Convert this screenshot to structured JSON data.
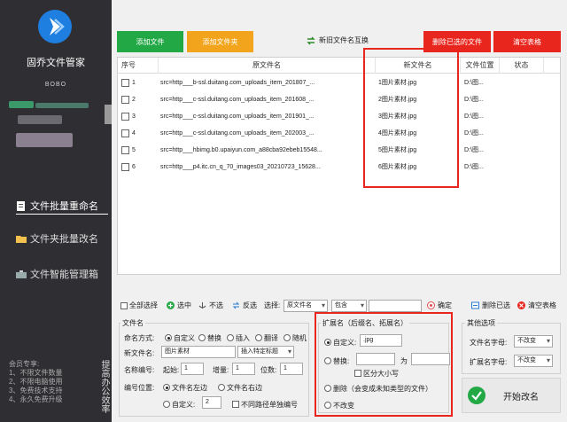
{
  "sidebar": {
    "app_title": "固乔文件管家",
    "app_subtitle": "BOBO",
    "nav": [
      {
        "label": "文件批量重命名"
      },
      {
        "label": "文件夹批量改名"
      },
      {
        "label": "文件智能管理箱"
      }
    ],
    "member_lines": [
      "会员专享:",
      "1、不限文件数量",
      "2、不限电脑使用",
      "3、免费技术支持",
      "4、永久免费升级"
    ],
    "vertical_text": "提高办公效率"
  },
  "toolbar": {
    "add_file": "添加文件",
    "add_folder": "添加文件夹",
    "swap_names": "新旧文件名互换",
    "delete_selected": "删除已选的文件",
    "clear_table": "清空表格"
  },
  "table": {
    "headers": {
      "index": "序号",
      "original": "原文件名",
      "new_name": "新文件名",
      "location": "文件位置",
      "status": "状态"
    },
    "rows": [
      {
        "index": "1",
        "original": "src=http___b-ssl.duitang.com_uploads_item_201807_...",
        "new_name": "1图片素材.jpg",
        "location": "D:\\图..."
      },
      {
        "index": "2",
        "original": "src=http___c-ssl.duitang.com_uploads_item_201608_...",
        "new_name": "2图片素材.jpg",
        "location": "D:\\图..."
      },
      {
        "index": "3",
        "original": "src=http___c-ssl.duitang.com_uploads_item_201901_...",
        "new_name": "3图片素材.jpg",
        "location": "D:\\图..."
      },
      {
        "index": "4",
        "original": "src=http___c-ssl.duitang.com_uploads_item_202003_...",
        "new_name": "4图片素材.jpg",
        "location": "D:\\图..."
      },
      {
        "index": "5",
        "original": "src=http___hbimg.b0.upaiyun.com_a88cba92ebeb15548...",
        "new_name": "5图片素材.jpg",
        "location": "D:\\图..."
      },
      {
        "index": "6",
        "original": "src=http___p4.itc.cn_q_70_images03_20210723_15628...",
        "new_name": "6图片素材.jpg",
        "location": "D:\\图..."
      }
    ]
  },
  "selection_bar": {
    "select_all": "全部选择",
    "select": "选中",
    "unselect": "不选",
    "invert": "反选",
    "select_label": "选择:",
    "field_value": "原文件名",
    "match_value": "包含",
    "confirm": "确定",
    "delete_selected": "删除已选",
    "clear_table": "清空表格"
  },
  "filename_panel": {
    "title": "文件名",
    "naming_label": "命名方式:",
    "naming_options": [
      "自定义",
      "替换",
      "插入",
      "翻译",
      "随机"
    ],
    "newname_label": "新文件名:",
    "newname_value": "图片素材",
    "insert_value": "插入特定标题",
    "numbering_label": "名称编号:",
    "start_label": "起始:",
    "start_value": "1",
    "step_label": "增量:",
    "step_value": "1",
    "digits_label": "位数:",
    "digits_value": "1",
    "position_label": "编号位置:",
    "position_options": [
      "文件名左边",
      "文件名右边",
      "自定义:"
    ],
    "position_custom_value": "2",
    "separate_path": "不同路径单独编号"
  },
  "extension_panel": {
    "title": "扩展名（后缀名、拓展名）",
    "custom_label": "自定义:",
    "custom_value": ".jpg",
    "replace_label": "替换:",
    "to_label": "为",
    "case_label": "区分大小写",
    "delete_label": "删除（会变成未知类型的文件）",
    "nochange_label": "不改变"
  },
  "other_panel": {
    "title": "其他选项",
    "filename_case_label": "文件名字母:",
    "filename_case_value": "不改变",
    "ext_case_label": "扩展名字母:",
    "ext_case_value": "不改变"
  },
  "start_button": "开始改名"
}
